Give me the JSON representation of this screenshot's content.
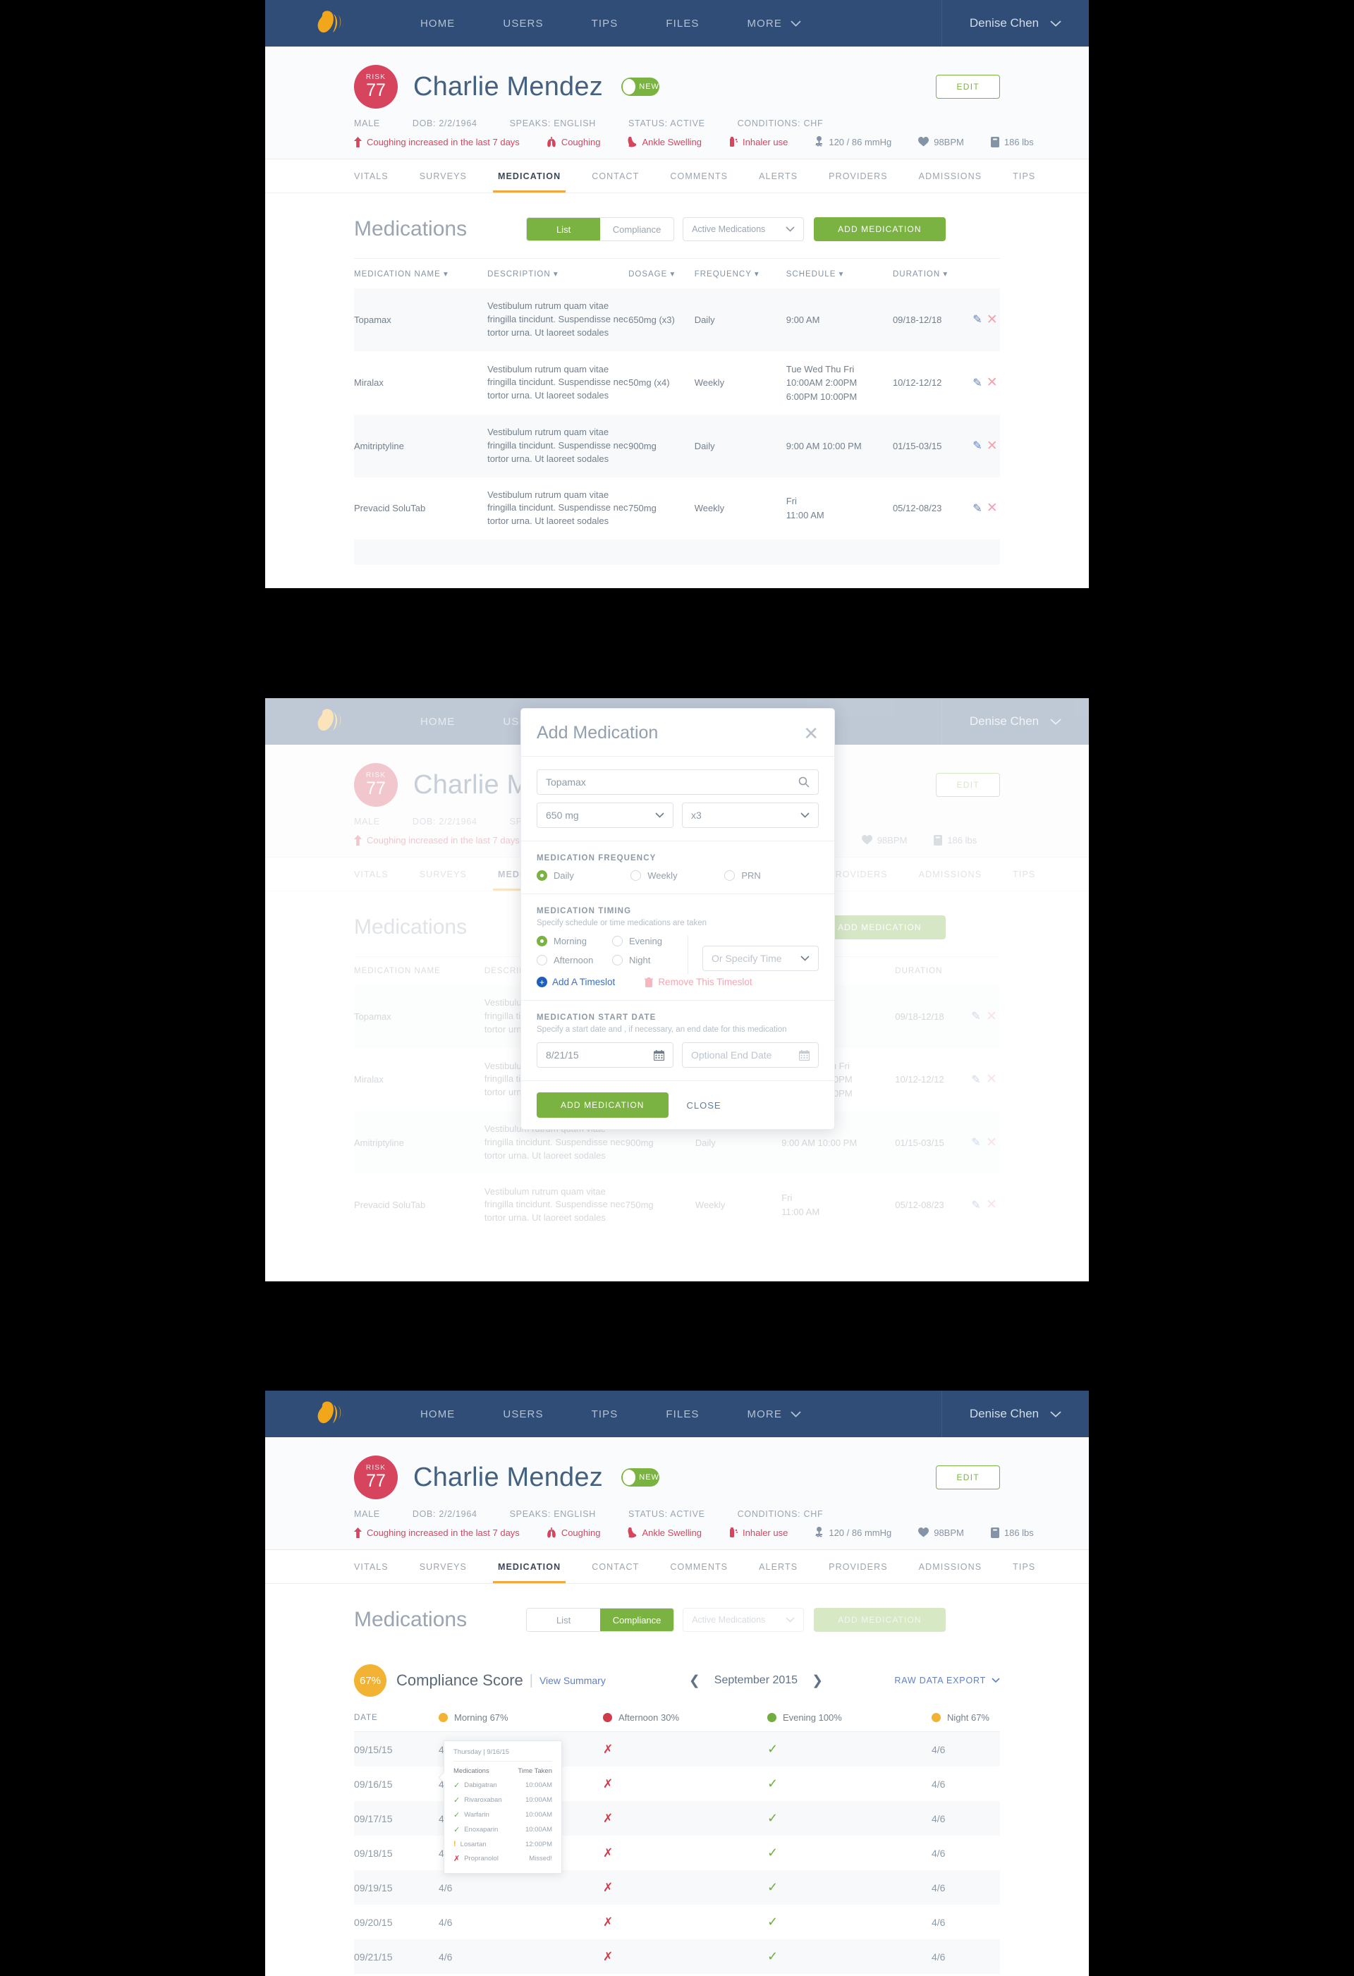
{
  "nav": {
    "logo_icon": "flame-logo-icon",
    "items": [
      {
        "label": "HOME"
      },
      {
        "label": "USERS"
      },
      {
        "label": "TIPS"
      },
      {
        "label": "FILES"
      },
      {
        "label": "MORE"
      }
    ],
    "user": "Denise Chen"
  },
  "patient": {
    "risk_label": "RISK",
    "risk_value": "77",
    "name": "Charlie Mendez",
    "status_toggle_label": "NEW",
    "edit_label": "EDIT",
    "meta": [
      "MALE",
      "DOB: 2/2/1964",
      "SPEAKS: ENGLISH",
      "STATUS: ACTIVE",
      "CONDITIONS: CHF"
    ],
    "vitals": [
      {
        "icon": "up-arrow-icon",
        "text": "Coughing increased in the last 7 days",
        "tone": "alert"
      },
      {
        "icon": "lungs-icon",
        "text": "Coughing",
        "tone": "alert"
      },
      {
        "icon": "ankle-icon",
        "text": "Ankle Swelling",
        "tone": "alert"
      },
      {
        "icon": "inhaler-icon",
        "text": "Inhaler use",
        "tone": "alert"
      },
      {
        "icon": "bp-cuff-icon",
        "text": "120 / 86 mmHg",
        "tone": "muted"
      },
      {
        "icon": "heart-icon",
        "text": "98BPM",
        "tone": "muted"
      },
      {
        "icon": "scale-icon",
        "text": "186 lbs",
        "tone": "muted"
      }
    ]
  },
  "subtabs": [
    {
      "label": "VITALS",
      "active": false
    },
    {
      "label": "SURVEYS",
      "active": false
    },
    {
      "label": "MEDICATION",
      "active": true
    },
    {
      "label": "CONTACT",
      "active": false
    },
    {
      "label": "COMMENTS",
      "active": false
    },
    {
      "label": "ALERTS",
      "active": false
    },
    {
      "label": "PROVIDERS",
      "active": false
    },
    {
      "label": "ADMISSIONS",
      "active": false
    },
    {
      "label": "TIPS",
      "active": false
    }
  ],
  "medications": {
    "title": "Medications",
    "seg_list": "List",
    "seg_compliance": "Compliance",
    "filter_selected": "Active Medications",
    "add_button": "ADD MEDICATION",
    "columns": [
      "MEDICATION NAME",
      "DESCRIPTION",
      "DOSAGE",
      "FREQUENCY",
      "SCHEDULE",
      "DURATION"
    ],
    "description_text": "Vestibulum rutrum quam vitae fringilla tincidunt. Suspendisse nec tortor urna. Ut laoreet sodales",
    "rows": [
      {
        "name": "Topamax",
        "dosage": "650mg (x3)",
        "frequency": "Daily",
        "schedule": "9:00 AM",
        "duration": "09/18-12/18"
      },
      {
        "name": "Miralax",
        "dosage": "50mg (x4)",
        "frequency": "Weekly",
        "schedule": "Tue Wed Thu Fri\n10:00AM  2:00PM\n6:00PM 10:00PM",
        "duration": "10/12-12/12"
      },
      {
        "name": "Amitriptyline",
        "dosage": "900mg",
        "frequency": "Daily",
        "schedule": "9:00 AM  10:00 PM",
        "duration": "01/15-03/15"
      },
      {
        "name": "Prevacid SoluTab",
        "dosage": "750mg",
        "frequency": "Weekly",
        "schedule": "Fri\n11:00 AM",
        "duration": "05/12-08/23"
      }
    ],
    "edit_icon": "pencil-icon",
    "delete_icon": "close-x-icon"
  },
  "modal": {
    "title": "Add Medication",
    "close_icon": "close-x-icon",
    "search_value": "Topamax",
    "search_icon": "search-icon",
    "dose_value": "650 mg",
    "multiplier_value": "x3",
    "frequency_label": "MEDICATION FREQUENCY",
    "frequency_options": [
      {
        "label": "Daily",
        "selected": true
      },
      {
        "label": "Weekly",
        "selected": false
      },
      {
        "label": "PRN",
        "selected": false
      }
    ],
    "timing_label": "MEDICATION TIMING",
    "timing_sub": "Specify schedule or time medications are taken",
    "timing_options": [
      {
        "label": "Morning",
        "selected": true
      },
      {
        "label": "Evening",
        "selected": false
      },
      {
        "label": "Afternoon",
        "selected": false
      },
      {
        "label": "Night",
        "selected": false
      }
    ],
    "specify_time_placeholder": "Or Specify Time",
    "add_timeslot": "Add A Timeslot",
    "remove_timeslot": "Remove This Timeslot",
    "remove_icon": "trash-icon",
    "add_icon": "plus-circle-icon",
    "startdate_label": "MEDICATION START DATE",
    "startdate_sub": "Specify a start date and , if necessary, an end date for this medication",
    "start_date_value": "8/21/15",
    "end_date_placeholder": "Optional End Date",
    "calendar_icon": "calendar-icon",
    "submit_label": "ADD MEDICATION",
    "close_label": "CLOSE"
  },
  "compliance": {
    "score": "67%",
    "title": "Compliance Score",
    "view_summary": "View Summary",
    "prev_icon": "chevron-left-icon",
    "next_icon": "chevron-right-icon",
    "month": "September 2015",
    "raw_export": "RAW DATA EXPORT",
    "date_header": "DATE",
    "legend": [
      {
        "label": "Morning 67%",
        "color": "#f2b233"
      },
      {
        "label": "Afternoon 30%",
        "color": "#cf3b4a"
      },
      {
        "label": "Evening 100%",
        "color": "#6fae3f"
      },
      {
        "label": "Night 67%",
        "color": "#f2b233"
      }
    ],
    "rows": [
      {
        "date": "09/15/15",
        "morning": "4/6",
        "afternoon": "x",
        "evening": "ok",
        "night": "4/6"
      },
      {
        "date": "09/16/15",
        "morning": "4/6",
        "afternoon": "x",
        "evening": "ok",
        "night": "4/6"
      },
      {
        "date": "09/17/15",
        "morning": "4/6",
        "afternoon": "x",
        "evening": "ok",
        "night": "4/6"
      },
      {
        "date": "09/18/15",
        "morning": "4/6",
        "afternoon": "x",
        "evening": "ok",
        "night": "4/6"
      },
      {
        "date": "09/19/15",
        "morning": "4/6",
        "afternoon": "x",
        "evening": "ok",
        "night": "4/6"
      },
      {
        "date": "09/20/15",
        "morning": "4/6",
        "afternoon": "x",
        "evening": "ok",
        "night": "4/6"
      },
      {
        "date": "09/21/15",
        "morning": "4/6",
        "afternoon": "x",
        "evening": "ok",
        "night": "4/6"
      }
    ],
    "tooltip": {
      "heading": "Thursday  |  9/16/15",
      "col_med": "Medications",
      "col_time": "Time Taken",
      "items": [
        {
          "status": "ok",
          "name": "Dabigatran",
          "time": "10:00AM"
        },
        {
          "status": "ok",
          "name": "Rivaroxaban",
          "time": "10:00AM"
        },
        {
          "status": "ok",
          "name": "Warfarin",
          "time": "10:00AM"
        },
        {
          "status": "ok",
          "name": "Enoxaparin",
          "time": "10:00AM"
        },
        {
          "status": "warn",
          "name": "Losartan",
          "time": "12:00PM"
        },
        {
          "status": "bad",
          "name": "Propranolol",
          "time": "Missed!"
        }
      ]
    }
  },
  "colors": {
    "nav_blue": "#2f4d76",
    "accent_green": "#7bb342",
    "risk_red": "#d6445e",
    "amber": "#f2b233",
    "link_blue": "#5f81c4"
  }
}
